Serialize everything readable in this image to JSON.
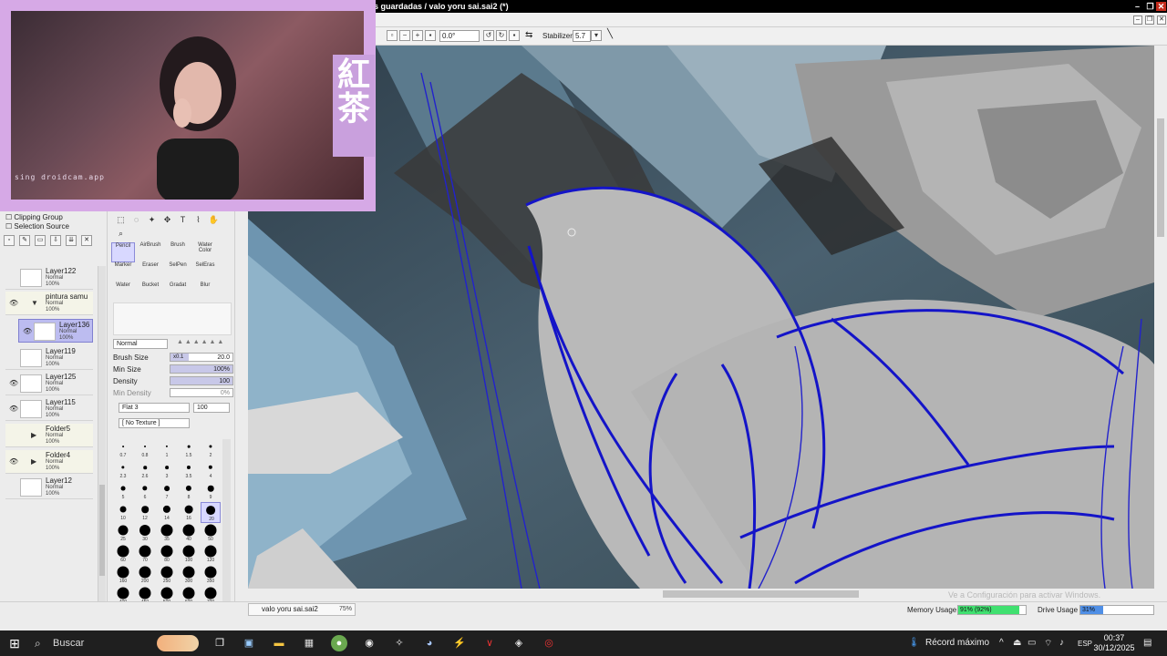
{
  "window": {
    "title": "s guardadas / valo yoru sai.sai2 (*)",
    "controls": [
      "–",
      "❐",
      "✕"
    ]
  },
  "toolbar": {
    "rotation_value": "0.0°",
    "stabilizer_label": "Stabilizer",
    "stabilizer_value": "5.7"
  },
  "webcam": {
    "watermark": "sing droidcam.app",
    "kanji": "紅\n茶"
  },
  "layer_panel": {
    "clipping_label": "Clipping Group",
    "selection_label": "Selection Source",
    "layers": [
      {
        "name": "Layer122",
        "blend": "Normal",
        "opacity": "100%",
        "visible": false,
        "type": "layer"
      },
      {
        "name": "pintura samu",
        "blend": "Normal",
        "opacity": "100%",
        "visible": true,
        "type": "folder-open"
      },
      {
        "name": "Layer136",
        "blend": "Normal",
        "opacity": "100%",
        "visible": true,
        "type": "layer",
        "selected": true
      },
      {
        "name": "Layer119",
        "blend": "Normal",
        "opacity": "100%",
        "visible": false,
        "type": "layer"
      },
      {
        "name": "Layer125",
        "blend": "Normal",
        "opacity": "100%",
        "visible": true,
        "type": "layer"
      },
      {
        "name": "Layer115",
        "blend": "Normal",
        "opacity": "100%",
        "visible": true,
        "type": "layer"
      },
      {
        "name": "Folder5",
        "blend": "Normal",
        "opacity": "100%",
        "visible": false,
        "type": "folder"
      },
      {
        "name": "Folder4",
        "blend": "Normal",
        "opacity": "100%",
        "visible": true,
        "type": "folder"
      },
      {
        "name": "Layer12",
        "blend": "Normal",
        "opacity": "100%",
        "visible": false,
        "type": "layer"
      }
    ]
  },
  "tool_panel": {
    "brushes": [
      {
        "name": "Pencil",
        "active": true
      },
      {
        "name": "AirBrush",
        "active": false
      },
      {
        "name": "Brush",
        "active": false
      },
      {
        "name": "Water Color",
        "active": false
      },
      {
        "name": "Marker",
        "active": false
      },
      {
        "name": "Eraser",
        "active": false
      },
      {
        "name": "SelPen",
        "active": false
      },
      {
        "name": "SelEras",
        "active": false
      },
      {
        "name": "Water",
        "active": false
      },
      {
        "name": "Bucket",
        "active": false
      },
      {
        "name": "Gradat",
        "active": false
      },
      {
        "name": "Blur",
        "active": false
      }
    ],
    "blend_mode": "Normal",
    "brush_size_label": "Brush Size",
    "brush_size_mult": "x0.1",
    "brush_size_value": "20.0",
    "min_size_label": "Min Size",
    "min_size_value": "100%",
    "density_label": "Density",
    "density_value": "100",
    "min_density_label": "Min Density",
    "min_density_value": "0%",
    "shape_value": "Flat 3",
    "shape_amount": "100",
    "texture_value": "[ No Texture ]",
    "size_presets": [
      "0.7",
      "0.8",
      "1",
      "1.5",
      "2",
      "2.3",
      "2.6",
      "3",
      "3.5",
      "4",
      "5",
      "6",
      "7",
      "8",
      "9",
      "10",
      "12",
      "14",
      "16",
      "20",
      "25",
      "30",
      "35",
      "40",
      "50",
      "60",
      "70",
      "80",
      "100",
      "120",
      "160",
      "200",
      "250",
      "300",
      "350",
      "400",
      "450",
      "500",
      "600",
      "700"
    ],
    "active_size": "20"
  },
  "canvas": {
    "doc_tab_name": "valo yoru sai.sai2",
    "zoom": "75%",
    "activate_notice": "Ve a Configuración para activar Windows."
  },
  "status": {
    "memory_label": "Memory Usage",
    "memory_value": "91% (92%)",
    "memory_fraction": 0.91,
    "memory_color": "#40e070",
    "drive_label": "Drive Usage",
    "drive_value": "31%",
    "drive_fraction": 0.31,
    "drive_color": "#4f8fe6"
  },
  "taskbar": {
    "search_placeholder": "Buscar",
    "weather_text": "Récord máximo",
    "language": "ESP",
    "time": "00:37",
    "date": "30/12/2025"
  }
}
